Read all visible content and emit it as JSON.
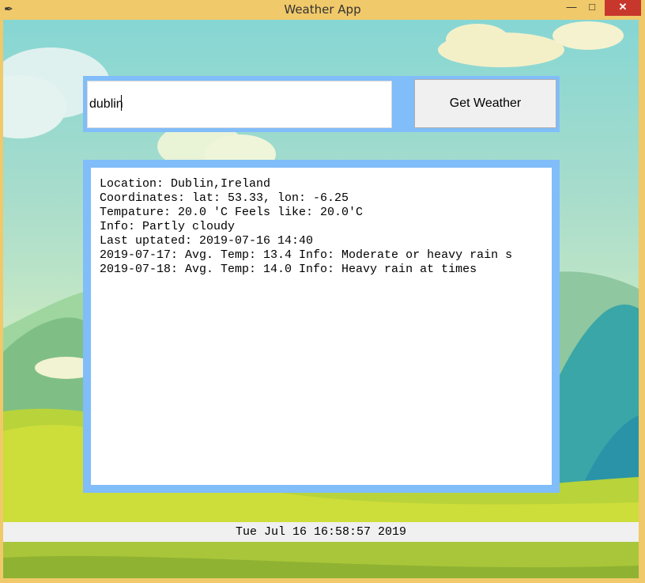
{
  "window": {
    "title": "Weather App",
    "app_icon": "feather-icon",
    "controls": {
      "minimize": "—",
      "maximize": "□",
      "close": "✕"
    }
  },
  "search": {
    "value": "dublin",
    "button_label": "Get Weather"
  },
  "output": {
    "lines": [
      "Location: Dublin,Ireland",
      "Coordinates: lat: 53.33, lon: -6.25",
      "Tempature: 20.0 'C Feels like: 20.0'C",
      "Info: Partly cloudy",
      "Last uptated: 2019-07-16 14:40",
      "2019-07-17: Avg. Temp: 13.4 Info: Moderate or heavy rain s",
      "2019-07-18: Avg. Temp: 14.0 Info: Heavy rain at times"
    ]
  },
  "status": {
    "datetime": "Tue Jul 16 16:58:57 2019"
  },
  "colors": {
    "titlebar": "#f0c96a",
    "close_button": "#c7372c",
    "frame_blue": "#80bdf9",
    "sky": "#86d6d4",
    "grass": "#c9dc3a"
  }
}
